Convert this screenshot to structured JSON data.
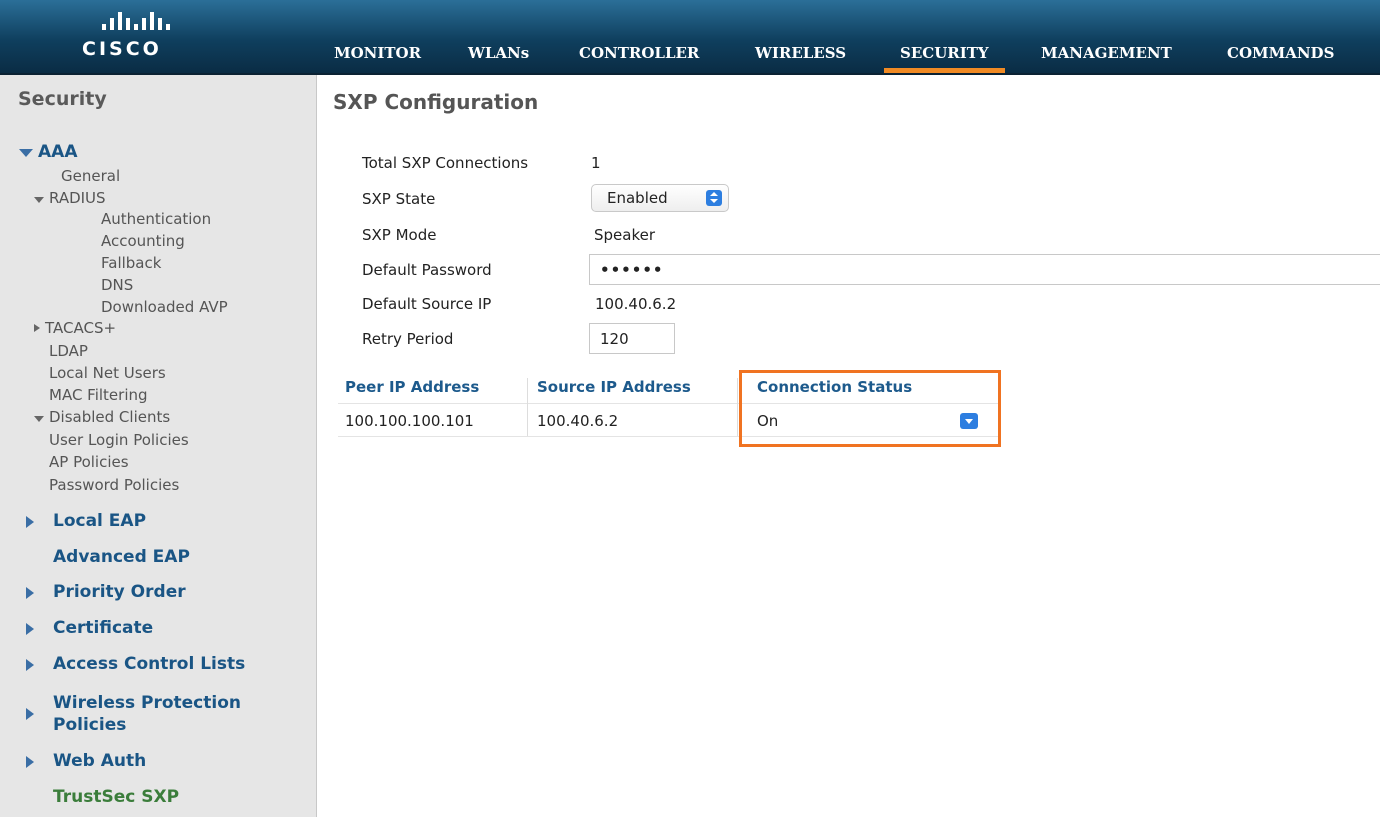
{
  "brand": {
    "logo_text": "CISCO"
  },
  "nav": {
    "items": [
      {
        "label": "MONITOR"
      },
      {
        "label": "WLANs"
      },
      {
        "label": "CONTROLLER"
      },
      {
        "label": "WIRELESS"
      },
      {
        "label": "SECURITY",
        "active": true
      },
      {
        "label": "MANAGEMENT"
      },
      {
        "label": "COMMANDS"
      }
    ]
  },
  "sidebar": {
    "title": "Security",
    "aaa": {
      "label": "AAA",
      "general": "General",
      "radius": {
        "label": "RADIUS",
        "children": [
          "Authentication",
          "Accounting",
          "Fallback",
          "DNS",
          "Downloaded AVP"
        ]
      },
      "tacacs": "TACACS+",
      "ldap": "LDAP",
      "local_net_users": "Local Net Users",
      "mac_filtering": "MAC Filtering",
      "disabled_clients": "Disabled Clients",
      "user_login_policies": "User Login Policies",
      "ap_policies": "AP Policies",
      "password_policies": "Password Policies"
    },
    "sections": [
      {
        "label": "Local EAP"
      },
      {
        "label": "Advanced EAP"
      },
      {
        "label": "Priority Order"
      },
      {
        "label": "Certificate"
      },
      {
        "label": "Access Control Lists"
      },
      {
        "label_line1": "Wireless Protection",
        "label_line2": "Policies"
      },
      {
        "label": "Web Auth"
      },
      {
        "label": "TrustSec SXP"
      }
    ]
  },
  "main": {
    "title": "SXP Configuration",
    "form": {
      "total_connections_label": "Total SXP Connections",
      "total_connections_value": "1",
      "state_label": "SXP State",
      "state_value": "Enabled",
      "mode_label": "SXP Mode",
      "mode_value": "Speaker",
      "password_label": "Default Password",
      "password_value": "••••••",
      "source_ip_label": "Default Source IP",
      "source_ip_value": "100.40.6.2",
      "retry_label": "Retry Period",
      "retry_value": "120"
    },
    "table": {
      "headers": [
        "Peer IP Address",
        "Source IP Address",
        "Connection Status"
      ],
      "rows": [
        {
          "peer_ip": "100.100.100.101",
          "source_ip": "100.40.6.2",
          "status": "On"
        }
      ]
    }
  },
  "colors": {
    "header_blue": "#0f3f5e",
    "active_underline": "#f08a24",
    "highlight_box": "#f07321",
    "link_blue": "#1a5585",
    "trustsec_green": "#3b7d3b"
  }
}
